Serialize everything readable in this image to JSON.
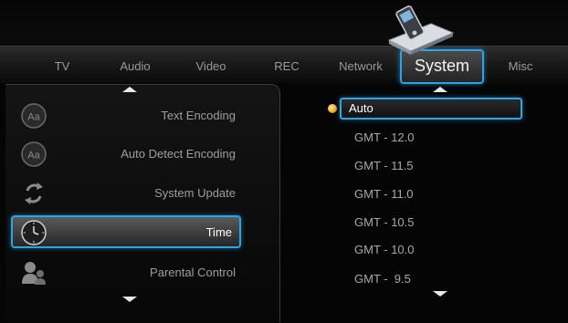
{
  "tabs": [
    {
      "label": "TV"
    },
    {
      "label": "Audio"
    },
    {
      "label": "Video"
    },
    {
      "label": "REC"
    },
    {
      "label": "Network"
    },
    {
      "label": "System",
      "active": true
    },
    {
      "label": "Misc"
    }
  ],
  "active_tab_icon": "media-player-device-icon",
  "menu": {
    "items": [
      {
        "label": "Text Encoding",
        "icon": "text-encoding-icon"
      },
      {
        "label": "Auto Detect Encoding",
        "icon": "auto-detect-encoding-icon"
      },
      {
        "label": "System Update",
        "icon": "system-update-icon"
      },
      {
        "label": "Time",
        "icon": "clock-icon",
        "selected": true
      },
      {
        "label": "Parental Control",
        "icon": "parental-control-icon"
      }
    ]
  },
  "options": {
    "items": [
      {
        "label": "Auto",
        "selected": true
      },
      {
        "label": "GMT - 12.0"
      },
      {
        "label": "GMT - 11.5"
      },
      {
        "label": "GMT - 11.0"
      },
      {
        "label": "GMT - 10.5"
      },
      {
        "label": "GMT - 10.0"
      },
      {
        "label": "GMT -  9.5"
      }
    ]
  },
  "icon_glyphs": {
    "text_encoding": "Aa",
    "auto_detect": "Aa"
  },
  "colors": {
    "accent": "#2aa5e6",
    "background": "#050505",
    "bullet": "#f2a81e"
  }
}
